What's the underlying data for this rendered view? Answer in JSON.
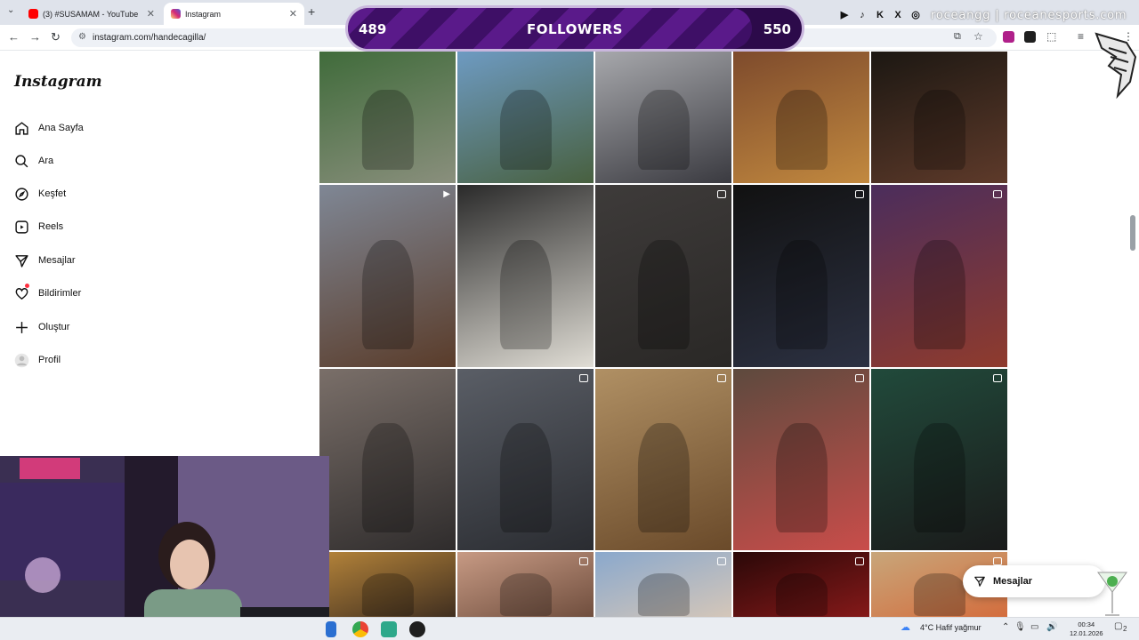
{
  "browser": {
    "tabs": [
      {
        "title": "(3) #SUSAMAM - YouTube",
        "active": false,
        "favicon_color": "#ff0000"
      },
      {
        "title": "Instagram",
        "active": true,
        "favicon_color": "#d62976"
      }
    ],
    "url": "instagram.com/handecagilla/"
  },
  "overlay": {
    "followers_current": "489",
    "followers_label": "FOLLOWERS",
    "followers_goal": "550",
    "progress_fraction": 0.89,
    "brand_text": "roceangg | roceanesports.com",
    "social_icons": [
      "youtube-icon",
      "tiktok-icon",
      "kick-icon",
      "x-icon",
      "instagram-icon"
    ]
  },
  "instagram": {
    "logo_text": "Instagram",
    "nav": [
      {
        "label": "Ana Sayfa",
        "icon": "home-icon"
      },
      {
        "label": "Ara",
        "icon": "search-icon"
      },
      {
        "label": "Keşfet",
        "icon": "compass-icon"
      },
      {
        "label": "Reels",
        "icon": "reels-icon"
      },
      {
        "label": "Mesajlar",
        "icon": "messenger-icon"
      },
      {
        "label": "Bildirimler",
        "icon": "heart-icon"
      },
      {
        "label": "Oluştur",
        "icon": "plus-icon"
      },
      {
        "label": "Profil",
        "icon": "avatar-icon"
      }
    ],
    "messages_button": "Mesajlar",
    "posts": [
      {
        "kind": "photo",
        "colors": [
          "#3f6b3a",
          "#8a8f7d"
        ]
      },
      {
        "kind": "photo",
        "colors": [
          "#6e9bc3",
          "#48603f"
        ]
      },
      {
        "kind": "photo",
        "colors": [
          "#a8a9ad",
          "#3a3a40"
        ]
      },
      {
        "kind": "photo",
        "colors": [
          "#7d4a2c",
          "#c2893f"
        ]
      },
      {
        "kind": "photo",
        "colors": [
          "#1b1712",
          "#5e3a2a"
        ]
      },
      {
        "kind": "reel",
        "colors": [
          "#7f8795",
          "#5a3c2a"
        ]
      },
      {
        "kind": "photo",
        "colors": [
          "#2a2a2a",
          "#e0ddd5"
        ]
      },
      {
        "kind": "carousel",
        "colors": [
          "#3e3b3a",
          "#2a2826"
        ]
      },
      {
        "kind": "carousel",
        "colors": [
          "#111111",
          "#2c3142"
        ]
      },
      {
        "kind": "carousel",
        "colors": [
          "#4b2d5c",
          "#8f3b2d"
        ]
      },
      {
        "kind": "photo",
        "colors": [
          "#7a6f69",
          "#2f2c2c"
        ]
      },
      {
        "kind": "carousel",
        "colors": [
          "#5a5e66",
          "#2a2c31"
        ]
      },
      {
        "kind": "carousel",
        "colors": [
          "#b09064",
          "#6a4a2a"
        ]
      },
      {
        "kind": "carousel",
        "colors": [
          "#5d4a3e",
          "#c94d4a"
        ]
      },
      {
        "kind": "carousel",
        "colors": [
          "#214a3b",
          "#1a1a1a"
        ]
      },
      {
        "kind": "photo",
        "colors": [
          "#b5843a",
          "#3a2a1e"
        ]
      },
      {
        "kind": "carousel",
        "colors": [
          "#c79a84",
          "#6b4a3a"
        ]
      },
      {
        "kind": "carousel",
        "colors": [
          "#8aa8cc",
          "#d8c8b8"
        ]
      },
      {
        "kind": "carousel",
        "colors": [
          "#2a0808",
          "#8a1a1a"
        ]
      },
      {
        "kind": "carousel",
        "colors": [
          "#c8a67a",
          "#d46a3a"
        ]
      }
    ]
  },
  "taskbar": {
    "weather": "4°C  Hafif yağmur",
    "time": "00:34",
    "date": "12.01.2026",
    "notification_count": "2"
  }
}
